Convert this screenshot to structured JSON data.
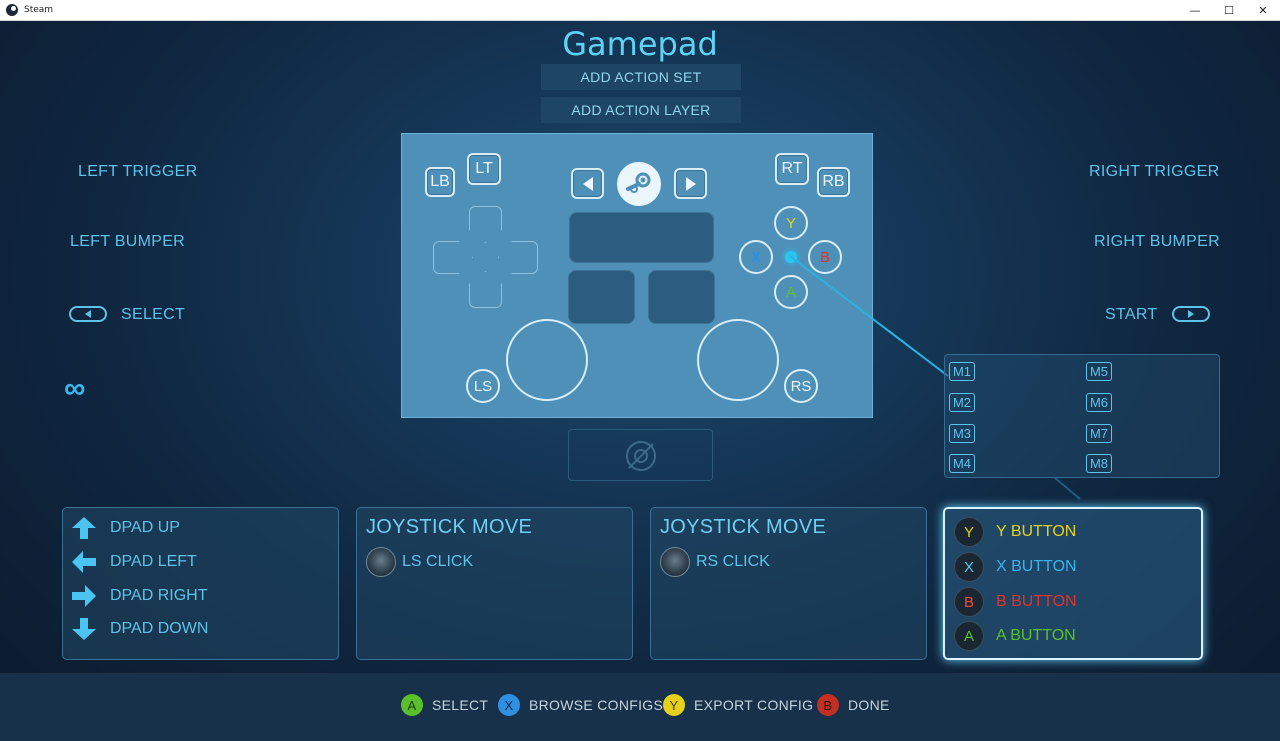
{
  "window": {
    "title": "Steam",
    "controls": {
      "minimize": "—",
      "maximize": "☐",
      "close": "✕"
    }
  },
  "header": {
    "title": "Gamepad",
    "add_action_set": "ADD ACTION SET",
    "add_action_layer": "ADD ACTION LAYER"
  },
  "left_labels": {
    "left_trigger": "LEFT TRIGGER",
    "left_bumper": "LEFT BUMPER",
    "select": "SELECT",
    "infinity_icon": "∞"
  },
  "right_labels": {
    "right_trigger": "RIGHT TRIGGER",
    "right_bumper": "RIGHT BUMPER",
    "start": "START"
  },
  "controller": {
    "lb": "LB",
    "lt": "LT",
    "rt": "RT",
    "rb": "RB",
    "y": "Y",
    "x": "X",
    "b": "B",
    "a": "A",
    "ls": "LS",
    "rs": "RS"
  },
  "macros": [
    "M1",
    "M5",
    "M2",
    "M6",
    "M3",
    "M7",
    "M4",
    "M8"
  ],
  "panels": {
    "dpad": {
      "up": "DPAD UP",
      "left": "DPAD LEFT",
      "right": "DPAD RIGHT",
      "down": "DPAD DOWN"
    },
    "left_stick": {
      "title": "JOYSTICK MOVE",
      "click": "LS CLICK"
    },
    "right_stick": {
      "title": "JOYSTICK MOVE",
      "click": "RS CLICK"
    },
    "face": {
      "y": {
        "key": "Y",
        "label": "Y BUTTON"
      },
      "x": {
        "key": "X",
        "label": "X BUTTON"
      },
      "b": {
        "key": "B",
        "label": "B BUTTON"
      },
      "a": {
        "key": "A",
        "label": "A BUTTON"
      }
    }
  },
  "footer": {
    "select": {
      "key": "A",
      "label": "SELECT"
    },
    "browse": {
      "key": "X",
      "label": "BROWSE CONFIGS"
    },
    "export": {
      "key": "Y",
      "label": "EXPORT CONFIG"
    },
    "done": {
      "key": "B",
      "label": "DONE"
    }
  },
  "colors": {
    "accent": "#5fc3e8",
    "y": "#e5d01c",
    "x": "#2f8fe0",
    "b": "#e0342a",
    "a": "#5bbf2a"
  }
}
